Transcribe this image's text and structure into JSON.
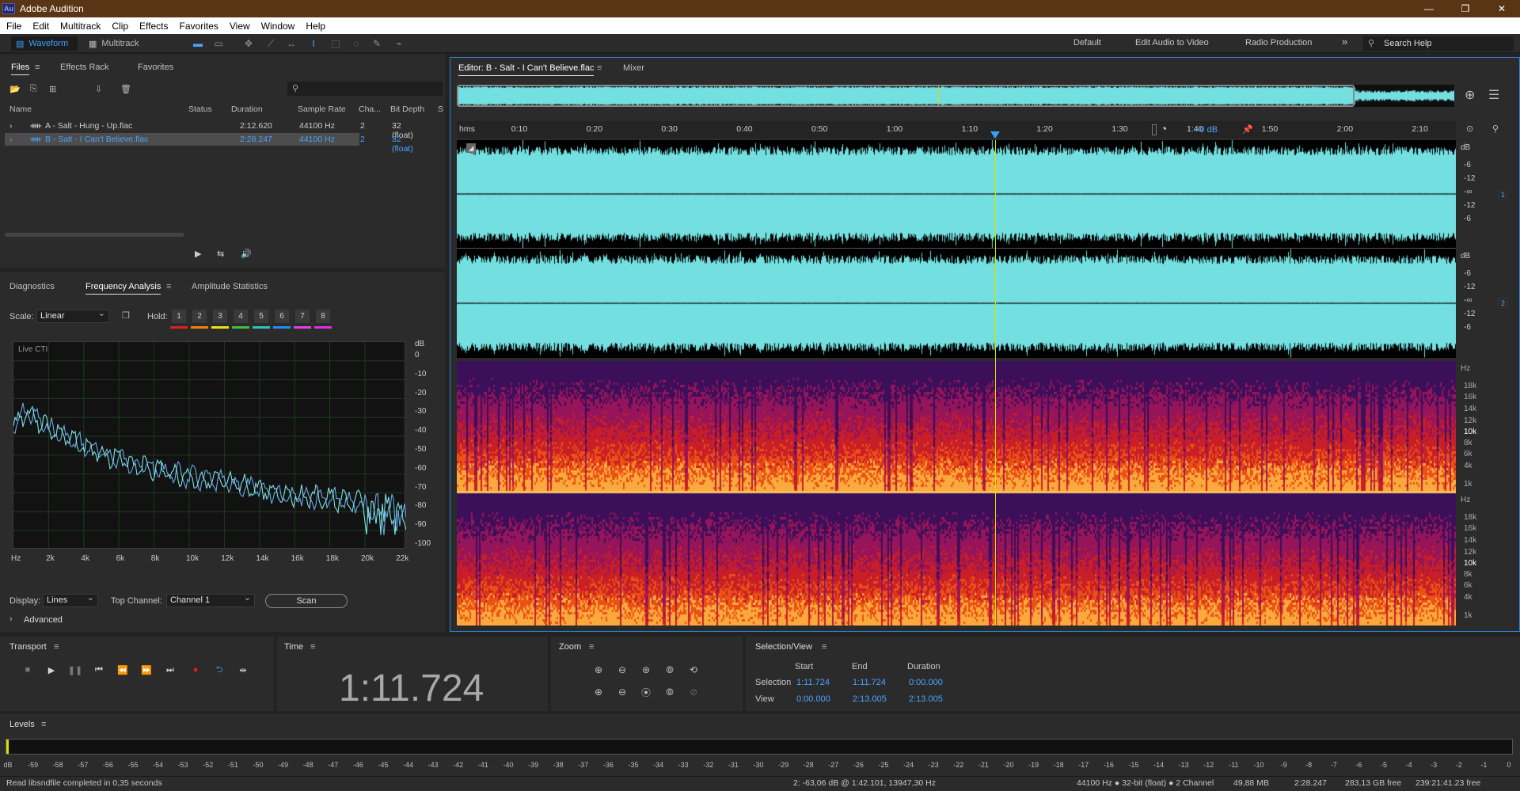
{
  "window": {
    "title": "Adobe Audition",
    "app_icon": "Au",
    "controls": [
      "—",
      "❐",
      "✕"
    ]
  },
  "menu": [
    "File",
    "Edit",
    "Multitrack",
    "Clip",
    "Effects",
    "Favorites",
    "View",
    "Window",
    "Help"
  ],
  "toolbar": {
    "waveform": "Waveform",
    "multitrack": "Multitrack",
    "workspaces": [
      "Default",
      "Edit Audio to Video",
      "Radio Production"
    ],
    "more": "»",
    "search_placeholder": "Search Help"
  },
  "files": {
    "tabs": [
      "Files",
      "Effects Rack",
      "Favorites"
    ],
    "columns": [
      "Name",
      "Status",
      "Duration",
      "Sample Rate",
      "Cha...",
      "Bit Depth",
      "S"
    ],
    "rows": [
      {
        "name": "A - Salt - Hung - Up.flac",
        "status": "",
        "duration": "2:12.620",
        "rate": "44100 Hz",
        "ch": "2",
        "depth": "32 (float)",
        "selected": false
      },
      {
        "name": "B - Salt - I Can't Believe.flac",
        "status": "",
        "duration": "2:28.247",
        "rate": "44100 Hz",
        "ch": "2",
        "depth": "32 (float)",
        "selected": true
      }
    ]
  },
  "analysis": {
    "tabs": [
      "Diagnostics",
      "Frequency Analysis",
      "Amplitude Statistics"
    ],
    "scale_label": "Scale:",
    "scale_value": "Linear",
    "hold_label": "Hold:",
    "holds": [
      "1",
      "2",
      "3",
      "4",
      "5",
      "6",
      "7",
      "8"
    ],
    "hold_colors": [
      "#e02020",
      "#f08010",
      "#f0e010",
      "#40c040",
      "#30c0c0",
      "#2090f0",
      "#e040e0",
      "#e030e0"
    ],
    "live_label": "Live CTI",
    "db_ticks": [
      "dB",
      "0",
      "-10",
      "-20",
      "-30",
      "-40",
      "-50",
      "-60",
      "-70",
      "-80",
      "-90",
      "-100"
    ],
    "hz_ticks": [
      "Hz",
      "2k",
      "4k",
      "6k",
      "8k",
      "10k",
      "12k",
      "14k",
      "16k",
      "18k",
      "20k",
      "22k"
    ],
    "display_label": "Display:",
    "display_value": "Lines",
    "top_channel_label": "Top Channel:",
    "top_channel_value": "Channel 1",
    "scan": "Scan",
    "advanced": "Advanced"
  },
  "editor": {
    "tab": "Editor: B - Salt - I Can't Believe.flac",
    "mixer": "Mixer",
    "timeline": [
      "hms",
      "0:10",
      "0:20",
      "0:30",
      "0:40",
      "0:50",
      "1:00",
      "1:10",
      "1:20",
      "1:30",
      "1:40",
      "1:50",
      "2:00",
      "2:10"
    ],
    "gain": "+0 dB",
    "db_scale": [
      "dB",
      "-6",
      "-12",
      "-∞",
      "-12",
      "-6"
    ],
    "channels": [
      "1",
      "2"
    ],
    "hz_scale": [
      "Hz",
      "18k",
      "16k",
      "14k",
      "12k",
      "10k",
      "8k",
      "6k",
      "4k",
      "1k"
    ]
  },
  "transport": {
    "title": "Transport"
  },
  "time": {
    "title": "Time",
    "value": "1:11.724"
  },
  "zoom": {
    "title": "Zoom"
  },
  "selview": {
    "title": "Selection/View",
    "cols": [
      "Start",
      "End",
      "Duration"
    ],
    "selection_label": "Selection",
    "view_label": "View",
    "selection": [
      "1:11.724",
      "1:11.724",
      "0:00.000"
    ],
    "view": [
      "0:00.000",
      "2:13.005",
      "2:13.005"
    ]
  },
  "levels": {
    "title": "Levels",
    "ticks": [
      "dB",
      "-59",
      "-58",
      "-57",
      "-56",
      "-55",
      "-54",
      "-53",
      "-52",
      "-51",
      "-50",
      "-49",
      "-48",
      "-47",
      "-46",
      "-45",
      "-44",
      "-43",
      "-42",
      "-41",
      "-40",
      "-39",
      "-38",
      "-37",
      "-36",
      "-35",
      "-34",
      "-33",
      "-32",
      "-31",
      "-30",
      "-29",
      "-28",
      "-27",
      "-26",
      "-25",
      "-24",
      "-23",
      "-22",
      "-21",
      "-20",
      "-19",
      "-18",
      "-17",
      "-16",
      "-15",
      "-14",
      "-13",
      "-12",
      "-11",
      "-10",
      "-9",
      "-8",
      "-7",
      "-6",
      "-5",
      "-4",
      "-3",
      "-2",
      "-1",
      "0"
    ]
  },
  "status": {
    "left": "Read libsndfile completed in 0,35 seconds",
    "cursor": "2: -63,06 dB @ 1:42.101, 13947,30 Hz",
    "format": "44100 Hz ● 32-bit (float) ● 2 Channel",
    "size": "49,88 MB",
    "duration": "2:28.247",
    "free": "283,13 GB free",
    "free_time": "239:21:41.23 free"
  },
  "colors": {
    "waveform": "#74dfe0",
    "accent": "#3aa0ff",
    "cti": "#d8e000",
    "titlebar": "#5a3515"
  }
}
